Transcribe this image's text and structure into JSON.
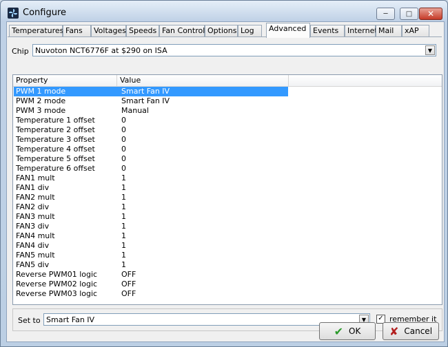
{
  "window": {
    "title": "Configure",
    "min_icon": "minimize-icon",
    "max_icon": "maximize-icon",
    "close_icon": "close-icon"
  },
  "tabs": [
    {
      "label": "Temperatures"
    },
    {
      "label": "Fans"
    },
    {
      "label": "Voltages"
    },
    {
      "label": "Speeds"
    },
    {
      "label": "Fan Control"
    },
    {
      "label": "Options"
    },
    {
      "label": "Log"
    },
    {
      "label": "Advanced",
      "active": true
    },
    {
      "label": "Events"
    },
    {
      "label": "Internet"
    },
    {
      "label": "Mail"
    },
    {
      "label": "xAP"
    }
  ],
  "chip": {
    "label": "Chip",
    "value": "Nuvoton NCT6776F at $290 on ISA"
  },
  "table": {
    "headers": {
      "property": "Property",
      "value": "Value"
    },
    "rows": [
      {
        "p": "PWM 1 mode",
        "v": "Smart Fan IV",
        "selected": true
      },
      {
        "p": "PWM 2 mode",
        "v": "Smart Fan IV"
      },
      {
        "p": "PWM 3 mode",
        "v": "Manual"
      },
      {
        "p": "Temperature 1 offset",
        "v": "0"
      },
      {
        "p": "Temperature 2 offset",
        "v": "0"
      },
      {
        "p": "Temperature 3 offset",
        "v": "0"
      },
      {
        "p": "Temperature 4 offset",
        "v": "0"
      },
      {
        "p": "Temperature 5 offset",
        "v": "0"
      },
      {
        "p": "Temperature 6 offset",
        "v": "0"
      },
      {
        "p": "FAN1 mult",
        "v": "1"
      },
      {
        "p": "FAN1 div",
        "v": "1"
      },
      {
        "p": "FAN2 mult",
        "v": "1"
      },
      {
        "p": "FAN2 div",
        "v": "1"
      },
      {
        "p": "FAN3 mult",
        "v": "1"
      },
      {
        "p": "FAN3 div",
        "v": "1"
      },
      {
        "p": "FAN4 mult",
        "v": "1"
      },
      {
        "p": "FAN4 div",
        "v": "1"
      },
      {
        "p": "FAN5 mult",
        "v": "1"
      },
      {
        "p": "FAN5 div",
        "v": "1"
      },
      {
        "p": "Reverse PWM01 logic",
        "v": "OFF"
      },
      {
        "p": "Reverse PWM02 logic",
        "v": "OFF"
      },
      {
        "p": "Reverse PWM03 logic",
        "v": "OFF"
      }
    ]
  },
  "set": {
    "label": "Set to",
    "value": "Smart Fan IV",
    "remember_label": "remember it",
    "remember_checked": true
  },
  "buttons": {
    "ok_label": "OK",
    "ok_icon": "check-icon",
    "cancel_label": "Cancel",
    "cancel_icon": "x-icon"
  },
  "colors": {
    "selection": "#3399ff",
    "ok_green": "#2a9a2a",
    "cancel_red": "#b32020"
  }
}
